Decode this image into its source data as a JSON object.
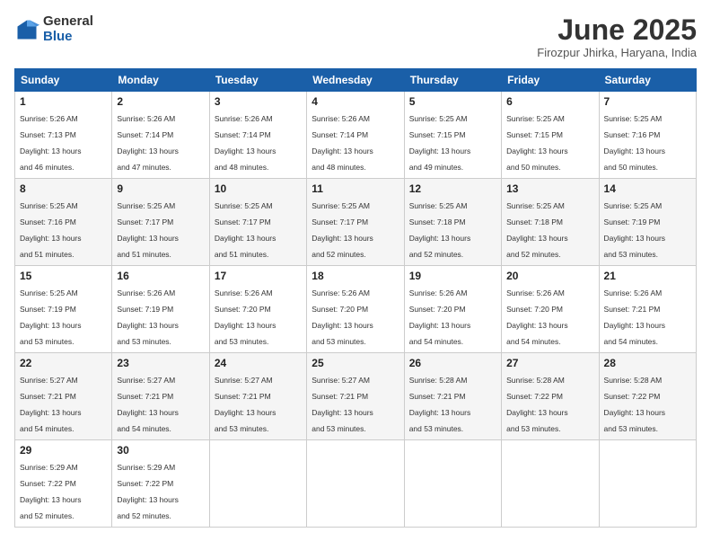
{
  "logo": {
    "general": "General",
    "blue": "Blue"
  },
  "header": {
    "title": "June 2025",
    "location": "Firozpur Jhirka, Haryana, India"
  },
  "weekdays": [
    "Sunday",
    "Monday",
    "Tuesday",
    "Wednesday",
    "Thursday",
    "Friday",
    "Saturday"
  ],
  "weeks": [
    [
      {
        "day": "1",
        "info": "Sunrise: 5:26 AM\nSunset: 7:13 PM\nDaylight: 13 hours\nand 46 minutes."
      },
      {
        "day": "2",
        "info": "Sunrise: 5:26 AM\nSunset: 7:14 PM\nDaylight: 13 hours\nand 47 minutes."
      },
      {
        "day": "3",
        "info": "Sunrise: 5:26 AM\nSunset: 7:14 PM\nDaylight: 13 hours\nand 48 minutes."
      },
      {
        "day": "4",
        "info": "Sunrise: 5:26 AM\nSunset: 7:14 PM\nDaylight: 13 hours\nand 48 minutes."
      },
      {
        "day": "5",
        "info": "Sunrise: 5:25 AM\nSunset: 7:15 PM\nDaylight: 13 hours\nand 49 minutes."
      },
      {
        "day": "6",
        "info": "Sunrise: 5:25 AM\nSunset: 7:15 PM\nDaylight: 13 hours\nand 50 minutes."
      },
      {
        "day": "7",
        "info": "Sunrise: 5:25 AM\nSunset: 7:16 PM\nDaylight: 13 hours\nand 50 minutes."
      }
    ],
    [
      {
        "day": "8",
        "info": "Sunrise: 5:25 AM\nSunset: 7:16 PM\nDaylight: 13 hours\nand 51 minutes."
      },
      {
        "day": "9",
        "info": "Sunrise: 5:25 AM\nSunset: 7:17 PM\nDaylight: 13 hours\nand 51 minutes."
      },
      {
        "day": "10",
        "info": "Sunrise: 5:25 AM\nSunset: 7:17 PM\nDaylight: 13 hours\nand 51 minutes."
      },
      {
        "day": "11",
        "info": "Sunrise: 5:25 AM\nSunset: 7:17 PM\nDaylight: 13 hours\nand 52 minutes."
      },
      {
        "day": "12",
        "info": "Sunrise: 5:25 AM\nSunset: 7:18 PM\nDaylight: 13 hours\nand 52 minutes."
      },
      {
        "day": "13",
        "info": "Sunrise: 5:25 AM\nSunset: 7:18 PM\nDaylight: 13 hours\nand 52 minutes."
      },
      {
        "day": "14",
        "info": "Sunrise: 5:25 AM\nSunset: 7:19 PM\nDaylight: 13 hours\nand 53 minutes."
      }
    ],
    [
      {
        "day": "15",
        "info": "Sunrise: 5:25 AM\nSunset: 7:19 PM\nDaylight: 13 hours\nand 53 minutes."
      },
      {
        "day": "16",
        "info": "Sunrise: 5:26 AM\nSunset: 7:19 PM\nDaylight: 13 hours\nand 53 minutes."
      },
      {
        "day": "17",
        "info": "Sunrise: 5:26 AM\nSunset: 7:20 PM\nDaylight: 13 hours\nand 53 minutes."
      },
      {
        "day": "18",
        "info": "Sunrise: 5:26 AM\nSunset: 7:20 PM\nDaylight: 13 hours\nand 53 minutes."
      },
      {
        "day": "19",
        "info": "Sunrise: 5:26 AM\nSunset: 7:20 PM\nDaylight: 13 hours\nand 54 minutes."
      },
      {
        "day": "20",
        "info": "Sunrise: 5:26 AM\nSunset: 7:20 PM\nDaylight: 13 hours\nand 54 minutes."
      },
      {
        "day": "21",
        "info": "Sunrise: 5:26 AM\nSunset: 7:21 PM\nDaylight: 13 hours\nand 54 minutes."
      }
    ],
    [
      {
        "day": "22",
        "info": "Sunrise: 5:27 AM\nSunset: 7:21 PM\nDaylight: 13 hours\nand 54 minutes."
      },
      {
        "day": "23",
        "info": "Sunrise: 5:27 AM\nSunset: 7:21 PM\nDaylight: 13 hours\nand 54 minutes."
      },
      {
        "day": "24",
        "info": "Sunrise: 5:27 AM\nSunset: 7:21 PM\nDaylight: 13 hours\nand 53 minutes."
      },
      {
        "day": "25",
        "info": "Sunrise: 5:27 AM\nSunset: 7:21 PM\nDaylight: 13 hours\nand 53 minutes."
      },
      {
        "day": "26",
        "info": "Sunrise: 5:28 AM\nSunset: 7:21 PM\nDaylight: 13 hours\nand 53 minutes."
      },
      {
        "day": "27",
        "info": "Sunrise: 5:28 AM\nSunset: 7:22 PM\nDaylight: 13 hours\nand 53 minutes."
      },
      {
        "day": "28",
        "info": "Sunrise: 5:28 AM\nSunset: 7:22 PM\nDaylight: 13 hours\nand 53 minutes."
      }
    ],
    [
      {
        "day": "29",
        "info": "Sunrise: 5:29 AM\nSunset: 7:22 PM\nDaylight: 13 hours\nand 52 minutes."
      },
      {
        "day": "30",
        "info": "Sunrise: 5:29 AM\nSunset: 7:22 PM\nDaylight: 13 hours\nand 52 minutes."
      },
      {
        "day": "",
        "info": ""
      },
      {
        "day": "",
        "info": ""
      },
      {
        "day": "",
        "info": ""
      },
      {
        "day": "",
        "info": ""
      },
      {
        "day": "",
        "info": ""
      }
    ]
  ]
}
